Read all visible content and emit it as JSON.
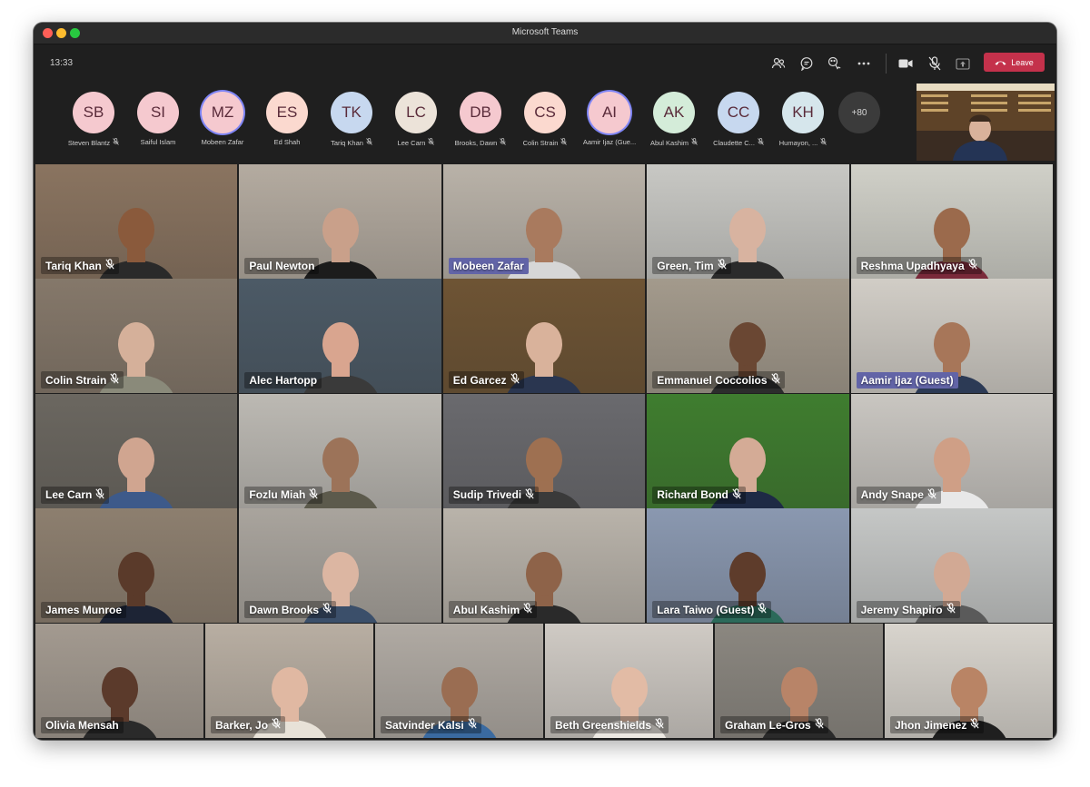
{
  "window": {
    "title": "Microsoft Teams"
  },
  "toolbar": {
    "time": "13:33",
    "icons": [
      "people-icon",
      "chat-icon",
      "reactions-icon",
      "more-icon",
      "camera-icon",
      "mic-off-icon",
      "share-icon"
    ],
    "leave_label": "Leave"
  },
  "participants": [
    {
      "initials": "SB",
      "name": "Steven Blantz",
      "color": "#f5c9cf",
      "muted": true
    },
    {
      "initials": "SI",
      "name": "Saiful Islam",
      "color": "#f5c9cf",
      "muted": false
    },
    {
      "initials": "MZ",
      "name": "Mobeen Zafar",
      "color": "#f5c9cf",
      "muted": false,
      "speaking": true
    },
    {
      "initials": "ES",
      "name": "Ed Shah",
      "color": "#fbd9cf",
      "muted": false
    },
    {
      "initials": "TK",
      "name": "Tariq Khan",
      "color": "#c7d8ef",
      "muted": true
    },
    {
      "initials": "LC",
      "name": "Lee Carn",
      "color": "#ece3d9",
      "muted": true
    },
    {
      "initials": "DB",
      "name": "Brooks, Dawn",
      "color": "#f5c9cf",
      "muted": true
    },
    {
      "initials": "CS",
      "name": "Colin Strain",
      "color": "#fbd9cf",
      "muted": true
    },
    {
      "initials": "AI",
      "name": "Aamir Ijaz (Gue...",
      "color": "#f5c9cf",
      "muted": false,
      "speaking": true
    },
    {
      "initials": "AK",
      "name": "Abul Kashim",
      "color": "#d4ecd9",
      "muted": true
    },
    {
      "initials": "CC",
      "name": "Claudette C...",
      "color": "#c7d8ef",
      "muted": true
    },
    {
      "initials": "KH",
      "name": "Humayon, ...",
      "color": "#d6e6ec",
      "muted": true
    }
  ],
  "overflow_count": "+80",
  "tiles": [
    {
      "name": "Tariq Khan",
      "muted": true,
      "bg": "#8a7460",
      "skin": "#8a5a3c",
      "shirt": "#2a2a2a"
    },
    {
      "name": "Paul Newton",
      "muted": false,
      "bg": "#b4aba0",
      "skin": "#c9a08a",
      "shirt": "#1c1c1c"
    },
    {
      "name": "Mobeen Zafar",
      "muted": false,
      "highlight": true,
      "bg": "#b9b2a8",
      "skin": "#a97a5e",
      "shirt": "#d6d6d6"
    },
    {
      "name": "Green, Tim",
      "muted": true,
      "bg": "#c8c8c4",
      "skin": "#d8b3a0",
      "shirt": "#2b2b2b"
    },
    {
      "name": "Reshma Upadhyaya",
      "muted": true,
      "bg": "#d0d0c8",
      "skin": "#9b6a4c",
      "shirt": "#7a2a3a"
    },
    {
      "name": "Colin Strain",
      "muted": true,
      "bg": "#85786a",
      "skin": "#d5b09a",
      "shirt": "#8a8a7a"
    },
    {
      "name": "Alec Hartopp",
      "muted": false,
      "bg": "#4c5a66",
      "skin": "#d9a58f",
      "shirt": "#3a3a3a"
    },
    {
      "name": "Ed Garcez",
      "muted": true,
      "bg": "#6e5434",
      "skin": "#d9b29b",
      "shirt": "#2a3650"
    },
    {
      "name": "Emmanuel Coccolios",
      "muted": true,
      "bg": "#a39a8c",
      "skin": "#6a4733",
      "shirt": "#2c2c2c"
    },
    {
      "name": "Aamir Ijaz (Guest)",
      "muted": false,
      "highlight": true,
      "bg": "#d1cdc6",
      "skin": "#a77659",
      "shirt": "#2c3a55"
    },
    {
      "name": "Lee Carn",
      "muted": true,
      "bg": "#6b6760",
      "skin": "#d0a590",
      "shirt": "#3d5a8a"
    },
    {
      "name": "Fozlu Miah",
      "muted": true,
      "bg": "#bcb9b3",
      "skin": "#9c7359",
      "shirt": "#5c5a4c"
    },
    {
      "name": "Sudip Trivedi",
      "muted": true,
      "bg": "#6a6a6e",
      "skin": "#9e7051",
      "shirt": "#3a3a3a"
    },
    {
      "name": "Richard Bond",
      "muted": true,
      "bg": "#3f7d2f",
      "skin": "#d4ab96",
      "shirt": "#1e2a45"
    },
    {
      "name": "Andy Snape",
      "muted": true,
      "bg": "#c9c6c1",
      "skin": "#cf9f86",
      "shirt": "#e8e8e8"
    },
    {
      "name": "James Munroe",
      "muted": false,
      "bg": "#8d7f6f",
      "skin": "#5a3a2a",
      "shirt": "#1d2435"
    },
    {
      "name": "Dawn Brooks",
      "muted": true,
      "bg": "#a9a49d",
      "skin": "#dcb6a2",
      "shirt": "#3b4f6a"
    },
    {
      "name": "Abul Kashim",
      "muted": true,
      "bg": "#b9b3aa",
      "skin": "#8e6349",
      "shirt": "#2a2a2a"
    },
    {
      "name": "Lara Taiwo (Guest)",
      "muted": true,
      "bg": "#8a98b0",
      "skin": "#5e3c2b",
      "shirt": "#2c6a5a"
    },
    {
      "name": "Jeremy Shapiro",
      "muted": true,
      "bg": "#c5c7c6",
      "skin": "#d2a994",
      "shirt": "#5a5a5a"
    },
    {
      "name": "Olivia Mensah",
      "muted": false,
      "bg": "#a39a90",
      "skin": "#5b3a2b",
      "shirt": "#2a2a2a"
    },
    {
      "name": "Barker, Jo",
      "muted": true,
      "bg": "#b8aea2",
      "skin": "#e0b8a2",
      "shirt": "#e8e2d8"
    },
    {
      "name": "Satvinder Kalsi",
      "muted": true,
      "bg": "#b0aaa3",
      "skin": "#9a6d52",
      "shirt": "#3a6aa0"
    },
    {
      "name": "Beth Greenshields",
      "muted": true,
      "bg": "#cfcac4",
      "skin": "#e2bba5",
      "shirt": "#ece8e2"
    },
    {
      "name": "Graham Le-Gros",
      "muted": true,
      "bg": "#8b8780",
      "skin": "#b88468",
      "shirt": "#2a2a2a"
    },
    {
      "name": "Jhon Jimenez",
      "muted": true,
      "bg": "#d8d4cd",
      "skin": "#b98465",
      "shirt": "#1f1f1f"
    }
  ]
}
